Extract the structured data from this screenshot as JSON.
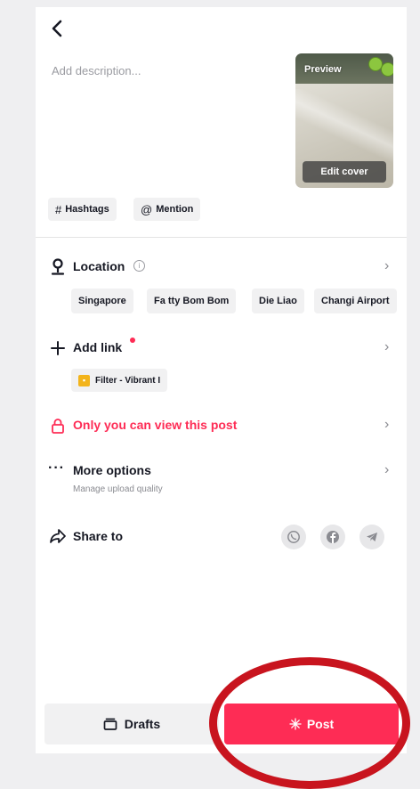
{
  "header": {
    "back_glyph": "‹"
  },
  "description": {
    "placeholder": "Add description..."
  },
  "cover": {
    "preview_label": "Preview",
    "edit_label": "Edit cover"
  },
  "chips": {
    "hashtags": "Hashtags",
    "mention": "Mention",
    "hashtag_symbol": "#",
    "mention_symbol": "@"
  },
  "location": {
    "title": "Location",
    "suggestions": [
      "Singapore",
      "Fa tty Bom Bom",
      "Die Liao",
      "Changi Airport"
    ]
  },
  "add_link": {
    "title": "Add link",
    "filter_label": "Filter - Vibrant I"
  },
  "privacy": {
    "title": "Only you can view this post",
    "accent": "#fe2c55"
  },
  "more_options": {
    "title": "More options",
    "subtitle": "Manage upload quality"
  },
  "share": {
    "title": "Share to",
    "targets": [
      "whatsapp-icon",
      "facebook-icon",
      "telegram-icon"
    ]
  },
  "bottom": {
    "drafts_label": "Drafts",
    "post_label": "Post"
  },
  "colors": {
    "post": "#fe2c55",
    "annotation": "#c8141e"
  }
}
